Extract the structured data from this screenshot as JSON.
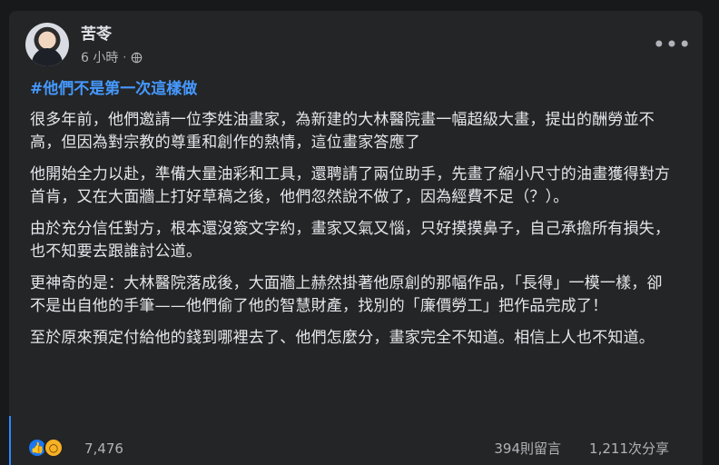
{
  "post": {
    "author_name": "苦苓",
    "timestamp": "6 小時",
    "separator": "·",
    "privacy_icon": "globe-icon",
    "more_icon": "more-options-icon",
    "hashtag": "#他們不是第一次這樣做",
    "paragraphs": [
      "很多年前，他們邀請一位李姓油畫家，為新建的大林醫院畫一幅超級大畫，提出的酬勞並不高，但因為對宗教的尊重和創作的熱情，這位畫家答應了",
      "他開始全力以赴，準備大量油彩和工具，還聘請了兩位助手，先畫了縮小尺寸的油畫獲得對方首肯，又在大面牆上打好草稿之後，他們忽然說不做了，因為經費不足（？）。",
      "由於充分信任對方，根本還沒簽文字約，畫家又氣又惱，只好摸摸鼻子，自己承擔所有損失，也不知要去跟誰討公道。",
      "更神奇的是：大林醫院落成後，大面牆上赫然掛著他原創的那幅作品，「長得」一模一樣，卻不是出自他的手筆——他們偷了他的智慧財產，找別的「廉價勞工」把作品完成了！",
      "至於原來預定付給他的錢到哪裡去了、他們怎麼分，畫家完全不知道。相信上人也不知道。"
    ],
    "reactions": {
      "like_icon": "like-icon",
      "wow_icon": "wow-icon",
      "count": "7,476"
    },
    "comments": "394則留言",
    "shares": "1,211次分享",
    "colors": {
      "background": "#18191a",
      "card": "#242526",
      "text": "#e4e6eb",
      "secondary": "#b0b3b8",
      "hashtag": "#4599ff",
      "like": "#1877f2",
      "wow": "#f7b125"
    }
  }
}
